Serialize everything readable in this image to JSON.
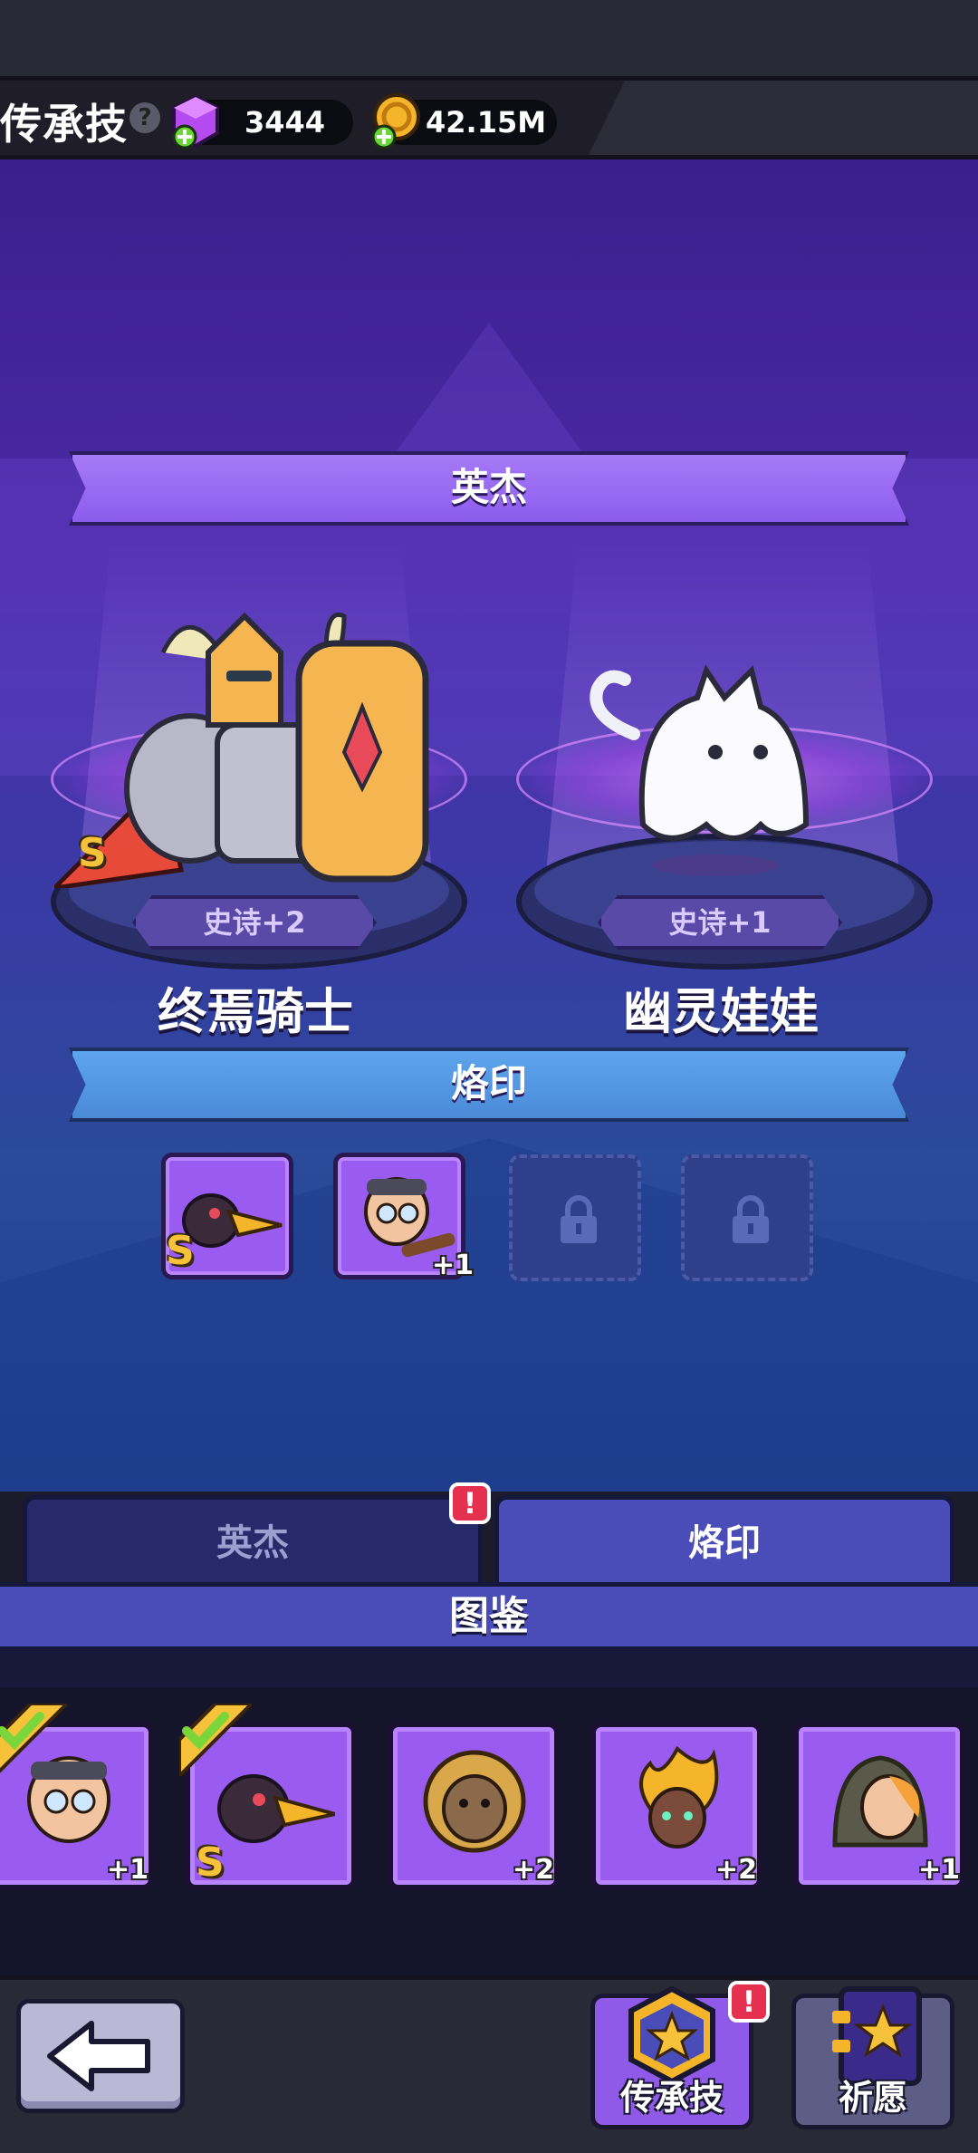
{
  "header": {
    "title": "传承技",
    "help_glyph": "?",
    "gems": "3444",
    "gold": "42.15M"
  },
  "showcase": {
    "heroes_ribbon": "英杰",
    "heroes": [
      {
        "name": "终焉骑士",
        "rarity": "史诗+2",
        "grade": "S"
      },
      {
        "name": "幽灵娃娃",
        "rarity": "史诗+1"
      }
    ],
    "imprint_ribbon": "烙印",
    "imprint_slots": [
      {
        "state": "filled",
        "grade": "S"
      },
      {
        "state": "filled",
        "plus": "+1"
      },
      {
        "state": "locked"
      },
      {
        "state": "locked"
      }
    ]
  },
  "tabs": {
    "heroes": "英杰",
    "imprint": "烙印",
    "active": "imprint",
    "alert_glyph": "!"
  },
  "codex": {
    "title": "图鉴",
    "cards": [
      {
        "plus": "+1",
        "checked": true
      },
      {
        "grade": "S",
        "checked": true
      },
      {
        "plus": "+2",
        "checked": false
      },
      {
        "plus": "+2",
        "checked": false
      },
      {
        "plus": "+1",
        "checked": false
      }
    ]
  },
  "bottom": {
    "inherit_label": "传承技",
    "wish_label": "祈愿",
    "alert_glyph": "!"
  },
  "colors": {
    "accent_purple": "#9a5cf0",
    "ribbon_blue": "#4a8ad8",
    "alert_red": "#e63050",
    "grade_gold": "#f5c23a"
  }
}
